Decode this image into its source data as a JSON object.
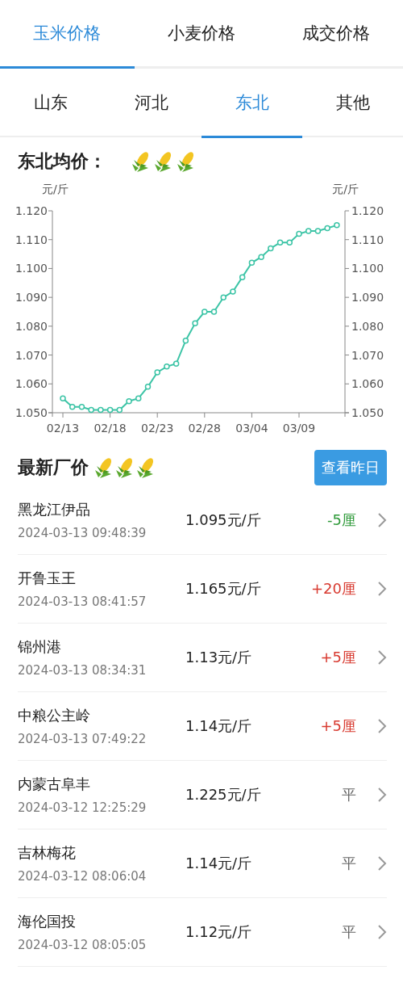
{
  "top_tabs": [
    {
      "label": "玉米价格",
      "selected": true
    },
    {
      "label": "小麦价格",
      "selected": false
    },
    {
      "label": "成交价格",
      "selected": false
    }
  ],
  "region_tabs": [
    {
      "label": "山东",
      "selected": false
    },
    {
      "label": "河北",
      "selected": false
    },
    {
      "label": "东北",
      "selected": true
    },
    {
      "label": "其他",
      "selected": false
    }
  ],
  "average": {
    "title": "东北均价：",
    "unit_left": "元/斤",
    "unit_right": "元/斤",
    "chart_data": {
      "type": "line",
      "categories": [
        "02/13",
        null,
        null,
        null,
        null,
        "02/18",
        null,
        null,
        null,
        null,
        "02/23",
        null,
        null,
        null,
        null,
        "02/28",
        null,
        null,
        null,
        null,
        "03/04",
        null,
        null,
        null,
        null,
        "03/09",
        null,
        null,
        null,
        null
      ],
      "series": [
        {
          "color": "#3cc4a6",
          "marker": "circle",
          "values": [
            1.055,
            1.052,
            1.052,
            1.051,
            1.051,
            1.051,
            1.051,
            1.054,
            1.055,
            1.059,
            1.064,
            1.066,
            1.067,
            1.075,
            1.081,
            1.085,
            1.085,
            1.09,
            1.092,
            1.097,
            1.102,
            1.104,
            1.107,
            1.109,
            1.109,
            1.112,
            1.113,
            1.113,
            1.114,
            1.115
          ]
        }
      ],
      "ylim": [
        1.05,
        1.12
      ],
      "yticks": [
        {
          "value": 1.05,
          "label": "1.050"
        },
        {
          "value": 1.06,
          "label": "1.060"
        },
        {
          "value": 1.07,
          "label": "1.070"
        },
        {
          "value": 1.08,
          "label": "1.080"
        },
        {
          "value": 1.09,
          "label": "1.090"
        },
        {
          "value": 1.1,
          "label": "1.100"
        },
        {
          "value": 1.11,
          "label": "1.110"
        },
        {
          "value": 1.12,
          "label": "1.120"
        }
      ]
    }
  },
  "latest": {
    "title": "最新厂价",
    "button": "查看昨日",
    "rows": [
      {
        "name": "黑龙江伊品",
        "time": "2024-03-13 09:48:39",
        "price": "1.095元/斤",
        "change": "-5厘",
        "kind": "down"
      },
      {
        "name": "开鲁玉王",
        "time": "2024-03-13 08:41:57",
        "price": "1.165元/斤",
        "change": "+20厘",
        "kind": "up"
      },
      {
        "name": "锦州港",
        "time": "2024-03-13 08:34:31",
        "price": "1.13元/斤",
        "change": "+5厘",
        "kind": "up"
      },
      {
        "name": "中粮公主岭",
        "time": "2024-03-13 07:49:22",
        "price": "1.14元/斤",
        "change": "+5厘",
        "kind": "up"
      },
      {
        "name": "内蒙古阜丰",
        "time": "2024-03-12 12:25:29",
        "price": "1.225元/斤",
        "change": "平",
        "kind": "flat"
      },
      {
        "name": "吉林梅花",
        "time": "2024-03-12 08:06:04",
        "price": "1.14元/斤",
        "change": "平",
        "kind": "flat"
      },
      {
        "name": "海伦国投",
        "time": "2024-03-12 08:05:05",
        "price": "1.12元/斤",
        "change": "平",
        "kind": "flat"
      }
    ]
  }
}
